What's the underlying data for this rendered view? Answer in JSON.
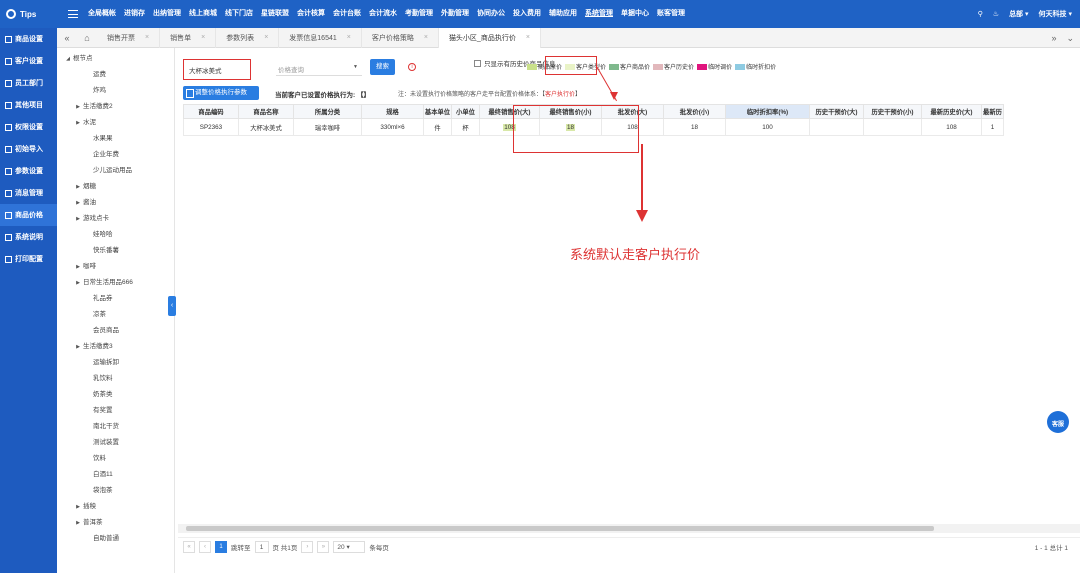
{
  "topbar": {
    "logo": "Tips",
    "nav": [
      "全局概帐",
      "进销存",
      "出纳管理",
      "线上商城",
      "线下门店",
      "星链联盟",
      "会计核算",
      "会计台账",
      "会计流水",
      "考勤管理",
      "外勤管理",
      "协同办公",
      "投入费用",
      "辅助应用",
      "系统管理",
      "单据中心",
      "账客管理"
    ],
    "active_nav": "系统管理",
    "user": "总部",
    "company": "何天科技"
  },
  "sidebar": {
    "items": [
      "商品设置",
      "客户设置",
      "员工部门",
      "其他项目",
      "权限设置",
      "初始导入",
      "参数设置",
      "消息管理",
      "商品价格",
      "系统说明",
      "打印配置"
    ],
    "active": "商品价格"
  },
  "tabs": {
    "items": [
      {
        "label": "销售开票",
        "active": false
      },
      {
        "label": "销售单",
        "active": false
      },
      {
        "label": "参数列表",
        "active": false
      },
      {
        "label": "发票信息16541",
        "active": false
      },
      {
        "label": "客户价格策略",
        "active": false
      },
      {
        "label": "猫头小区_商品执行价",
        "active": true
      }
    ]
  },
  "tree": {
    "items": [
      {
        "label": "根节点",
        "level": 0,
        "arrow": "down"
      },
      {
        "label": "运费",
        "level": 2,
        "arrow": ""
      },
      {
        "label": "炸鸡",
        "level": 2,
        "arrow": ""
      },
      {
        "label": "生活缴费2",
        "level": 1,
        "arrow": "right"
      },
      {
        "label": "水泥",
        "level": 1,
        "arrow": "right"
      },
      {
        "label": "水果果",
        "level": 2,
        "arrow": ""
      },
      {
        "label": "企业年费",
        "level": 2,
        "arrow": ""
      },
      {
        "label": "少儿运动用品",
        "level": 2,
        "arrow": ""
      },
      {
        "label": "烟糖",
        "level": 1,
        "arrow": "right"
      },
      {
        "label": "酱油",
        "level": 1,
        "arrow": "right"
      },
      {
        "label": "游戏点卡",
        "level": 1,
        "arrow": "right"
      },
      {
        "label": "娃哈哈",
        "level": 2,
        "arrow": ""
      },
      {
        "label": "快乐番薯",
        "level": 2,
        "arrow": ""
      },
      {
        "label": "咖啡",
        "level": 1,
        "arrow": "right"
      },
      {
        "label": "日常生活用品666",
        "level": 1,
        "arrow": "right"
      },
      {
        "label": "礼品券",
        "level": 2,
        "arrow": ""
      },
      {
        "label": "凉茶",
        "level": 2,
        "arrow": ""
      },
      {
        "label": "会员商品",
        "level": 2,
        "arrow": ""
      },
      {
        "label": "生活缴费3",
        "level": 1,
        "arrow": "right"
      },
      {
        "label": "运输拆卸",
        "level": 2,
        "arrow": ""
      },
      {
        "label": "乳饮料",
        "level": 2,
        "arrow": ""
      },
      {
        "label": "奶茶类",
        "level": 2,
        "arrow": ""
      },
      {
        "label": "有奖置",
        "level": 2,
        "arrow": ""
      },
      {
        "label": "南北干货",
        "level": 2,
        "arrow": ""
      },
      {
        "label": "测试装置",
        "level": 2,
        "arrow": ""
      },
      {
        "label": "饮料",
        "level": 2,
        "arrow": ""
      },
      {
        "label": "白酒11",
        "level": 2,
        "arrow": ""
      },
      {
        "label": "袋泡茶",
        "level": 2,
        "arrow": ""
      },
      {
        "label": "插秧",
        "level": 1,
        "arrow": "right"
      },
      {
        "label": "普洱茶",
        "level": 1,
        "arrow": "right"
      },
      {
        "label": "自助普通",
        "level": 2,
        "arrow": ""
      }
    ]
  },
  "toolbar": {
    "search_value": "大杯冰美式",
    "price_placeholder": "价格查询",
    "search_btn": "搜索",
    "history_check": "只显示有历史价商品信息",
    "adjust_btn": "调整价格执行参数",
    "current_level": "当前客户已设置价格执行为: 【】",
    "note_prefix": "注：未设置执行价格策略的客户走平台配置价格体系：【",
    "note_red": "客户执行价",
    "note_suffix": "】"
  },
  "legend": [
    {
      "label": "商品原价",
      "color": "#c9e08a"
    },
    {
      "label": "客户类型价",
      "color": "#e9f3c7"
    },
    {
      "label": "客户商品价",
      "color": "#7fb98d"
    },
    {
      "label": "客户历史价",
      "color": "#e2b8bc"
    },
    {
      "label": "临时调价",
      "color": "#e0157e"
    },
    {
      "label": "临时折扣价",
      "color": "#8ecbe2"
    }
  ],
  "table": {
    "headers": [
      "商品编码",
      "商品名称",
      "所属分类",
      "规格",
      "基本单位",
      "小单位",
      "最终销售价(大)",
      "最终销售价(小)",
      "批发价(大)",
      "批发价(小)",
      "临时折扣率(%)",
      "历史干预价(大)",
      "历史干预价(小)",
      "最新历史价(大)",
      "最新历"
    ],
    "rows": [
      [
        "SP2363",
        "大杯冰美式",
        "瑞幸咖啡",
        "330ml×6",
        "件",
        "杯",
        "108",
        "18",
        "108",
        "18",
        "100",
        "",
        "",
        "108",
        "1"
      ]
    ]
  },
  "annotation": "系统默认走客户执行价",
  "pager": {
    "current": "1",
    "goto": "跳转至",
    "goto_val": "1",
    "page_total": "页 共1页",
    "size": "20",
    "per_page": "条每页",
    "summary": "1 - 1 总计 1"
  },
  "service": "客服"
}
